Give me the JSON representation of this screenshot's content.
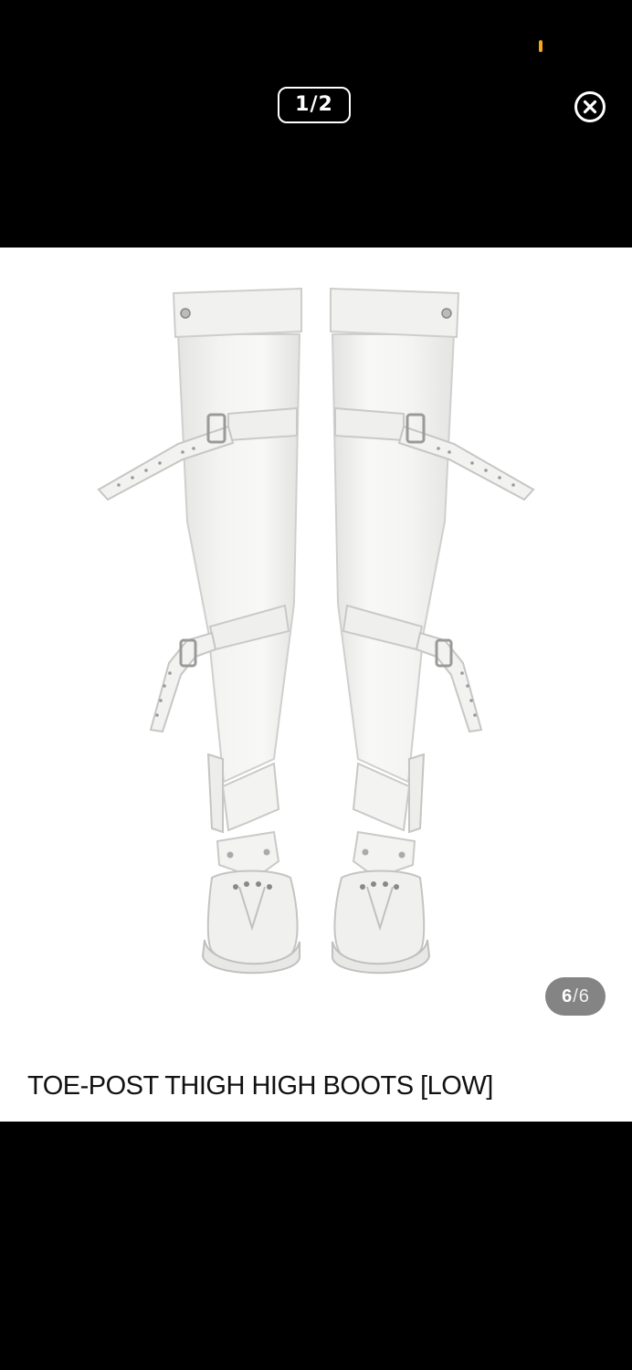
{
  "viewer": {
    "page_counter": "1/2",
    "close_label": "close"
  },
  "product": {
    "title": "TOE-POST THIGH HIGH BOOTS [LOW]",
    "image_alt": "White toe-post thigh high boots with buckle straps",
    "image_counter": {
      "current": "6",
      "separator": "/",
      "total": "6"
    }
  },
  "icons": {
    "close": "close-circle-icon"
  },
  "colors": {
    "background": "#000000",
    "card": "#ffffff",
    "status_indicator": "#f5a623",
    "counter_badge": "#6e6e6e"
  }
}
